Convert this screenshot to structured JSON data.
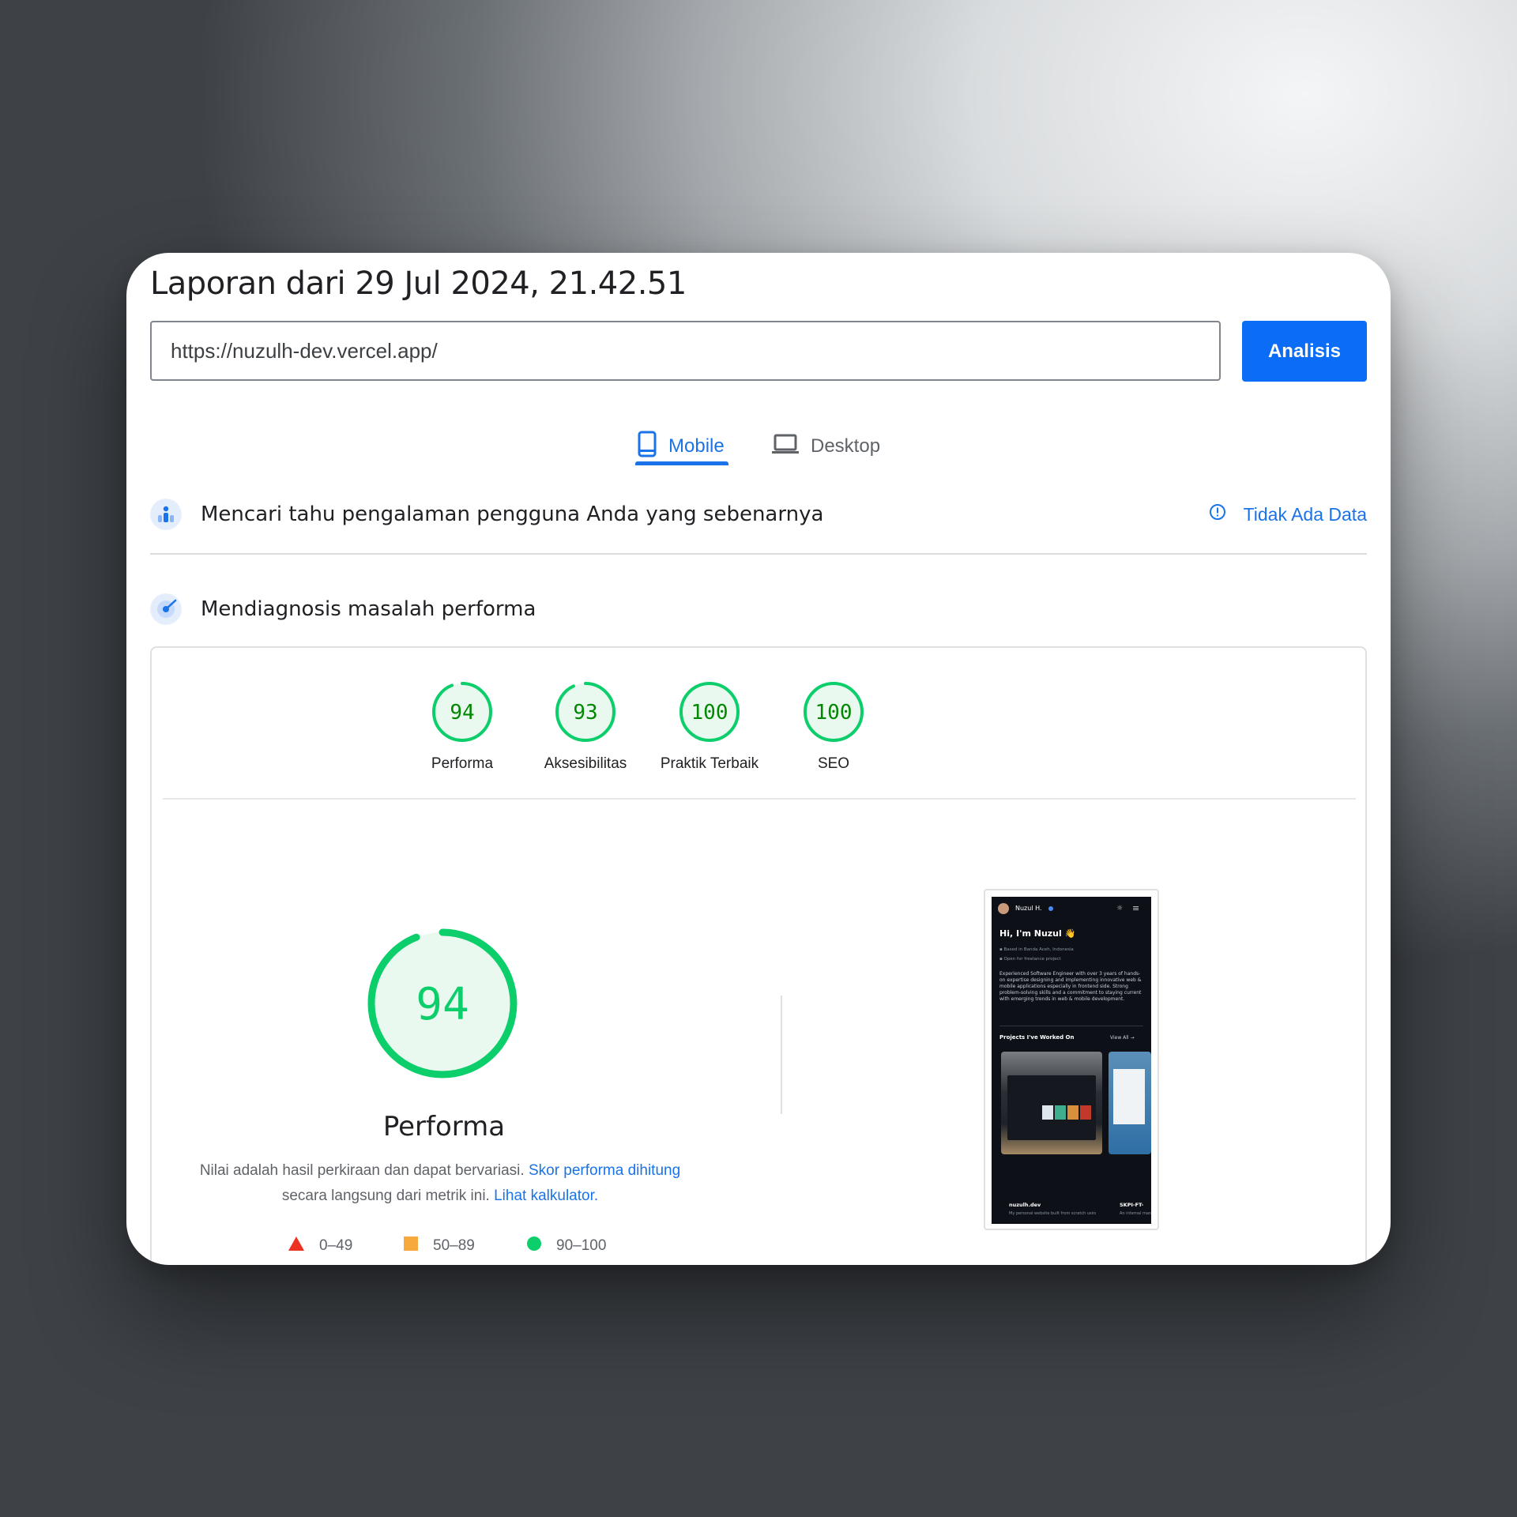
{
  "report": {
    "title": "Laporan dari 29 Jul 2024, 21.42.51"
  },
  "search": {
    "url": "https://nuzulh-dev.vercel.app/",
    "button_label": "Analisis"
  },
  "tabs": [
    {
      "label": "Mobile",
      "icon": "smartphone-icon",
      "active": true
    },
    {
      "label": "Desktop",
      "icon": "laptop-icon",
      "active": false
    }
  ],
  "field_data": {
    "title": "Mencari tahu pengalaman pengguna Anda yang sebenarnya",
    "status": "Tidak Ada Data"
  },
  "lab_data": {
    "title": "Mendiagnosis masalah performa"
  },
  "scores": [
    {
      "label": "Performa",
      "value": 94
    },
    {
      "label": "Aksesibilitas",
      "value": 93
    },
    {
      "label": "Praktik Terbaik",
      "value": 100
    },
    {
      "label": "SEO",
      "value": 100
    }
  ],
  "main_score": {
    "value": 94,
    "label": "Performa",
    "desc_text_1": "Nilai adalah hasil perkiraan dan dapat bervariasi.",
    "desc_link_1": "Skor performa dihitung",
    "desc_text_2": "secara langsung dari metrik ini.",
    "desc_link_2": "Lihat kalkulator."
  },
  "legend": [
    {
      "range": "0–49",
      "shape": "triangle",
      "color": "#eb3223"
    },
    {
      "range": "50–89",
      "shape": "square",
      "color": "#f7a93b"
    },
    {
      "range": "90–100",
      "shape": "circle",
      "color": "#0cce6b"
    }
  ],
  "colors": {
    "pass": "#0cce6b",
    "pass_text": "#008800",
    "pass_fill": "#eaf9f0",
    "accent": "#1a73e8"
  },
  "screenshot": {
    "site_name": "Nuzul H.",
    "heading": "Hi, I'm Nuzul 👋",
    "bullet_1": "Based in Banda Aceh, Indonesia",
    "bullet_2": "Open for freelance project",
    "bio": "Experienced Software Engineer with over 3 years of hands-on expertise designing and implementing innovative web & mobile applications especially in frontend side. Strong problem-solving skills and a commitment to staying current with emerging trends in web & mobile development.",
    "projects_title": "Projects I've Worked On",
    "view_all": "View All →",
    "card1_title": "nuzulh.dev",
    "card1_desc": "My personal website built from scratch using a modern approach to...",
    "card2_title": "SKPI-FT-",
    "card2_desc": "An internal management..."
  }
}
